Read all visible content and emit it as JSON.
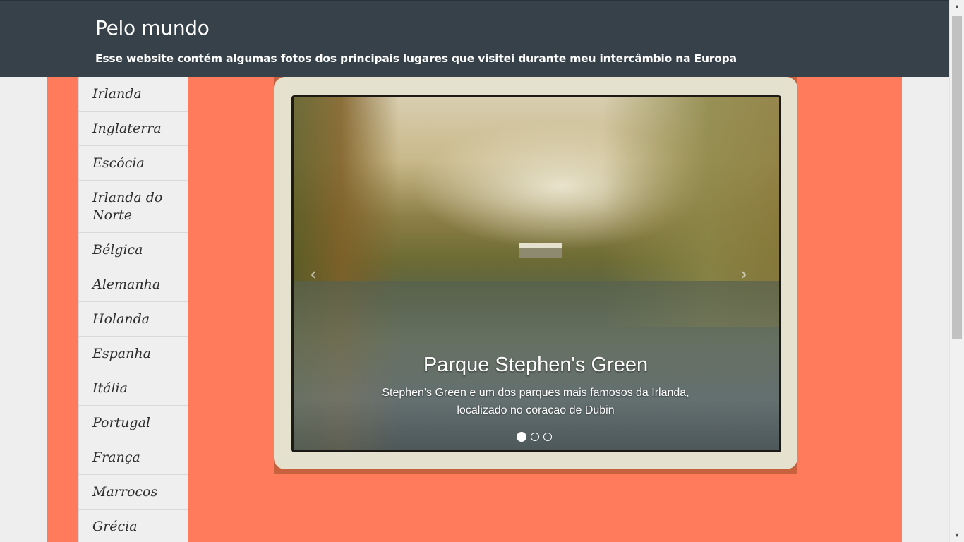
{
  "header": {
    "title": "Pelo mundo",
    "subtitle": "Esse website contém algumas fotos dos principais lugares que visitei durante meu intercâmbio na Europa"
  },
  "sidebar": {
    "items": [
      {
        "label": "Irlanda"
      },
      {
        "label": "Inglaterra"
      },
      {
        "label": "Escócia"
      },
      {
        "label": "Irlanda do Norte"
      },
      {
        "label": "Bélgica"
      },
      {
        "label": "Alemanha"
      },
      {
        "label": "Holanda"
      },
      {
        "label": "Espanha"
      },
      {
        "label": "Itália"
      },
      {
        "label": "Portugal"
      },
      {
        "label": "França"
      },
      {
        "label": "Marrocos"
      },
      {
        "label": "Grécia"
      }
    ]
  },
  "carousel": {
    "prev_icon": "‹",
    "next_icon": "›",
    "caption_title": "Parque Stephen's Green",
    "caption_text": "Stephen's Green e um dos parques mais famosos da Irlanda, localizado no coracao de Dubin",
    "slide_count": 3,
    "active_slide": 1
  },
  "scrollbar": {
    "up_icon": "▲",
    "down_icon": "▼"
  },
  "colors": {
    "header_bg": "#37414a",
    "content_bg": "#ff7b5c",
    "page_bg": "#eeeeee"
  }
}
